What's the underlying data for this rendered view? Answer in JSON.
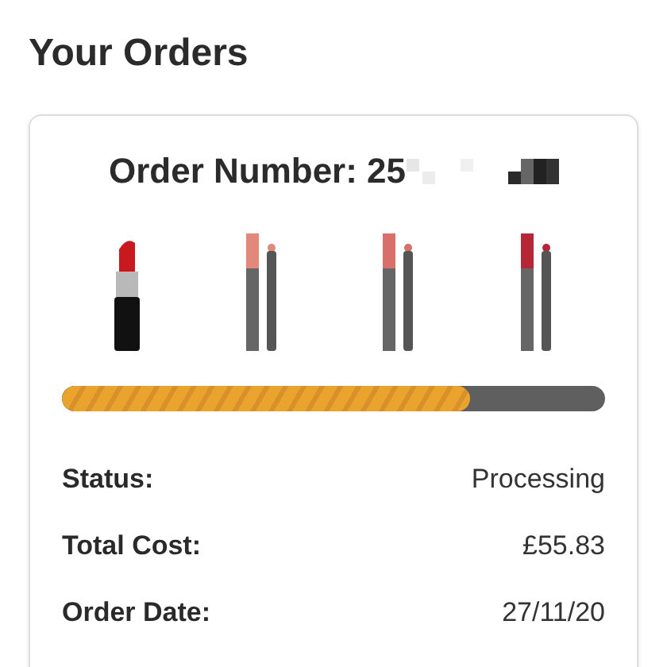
{
  "page_title": "Your Orders",
  "order": {
    "number_label": "Order Number: 25",
    "products": [
      {
        "kind": "lipstick",
        "color": "#c8191f"
      },
      {
        "kind": "pencil",
        "color": "#e2897c"
      },
      {
        "kind": "pencil",
        "color": "#d86f6b"
      },
      {
        "kind": "pencil",
        "color": "#b52737"
      }
    ],
    "progress": {
      "level": 0.75
    },
    "details": [
      {
        "label": "Status:",
        "value": "Processing"
      },
      {
        "label": "Total Cost:",
        "value": "£55.83"
      },
      {
        "label": "Order Date:",
        "value": "27/11/20"
      }
    ]
  }
}
